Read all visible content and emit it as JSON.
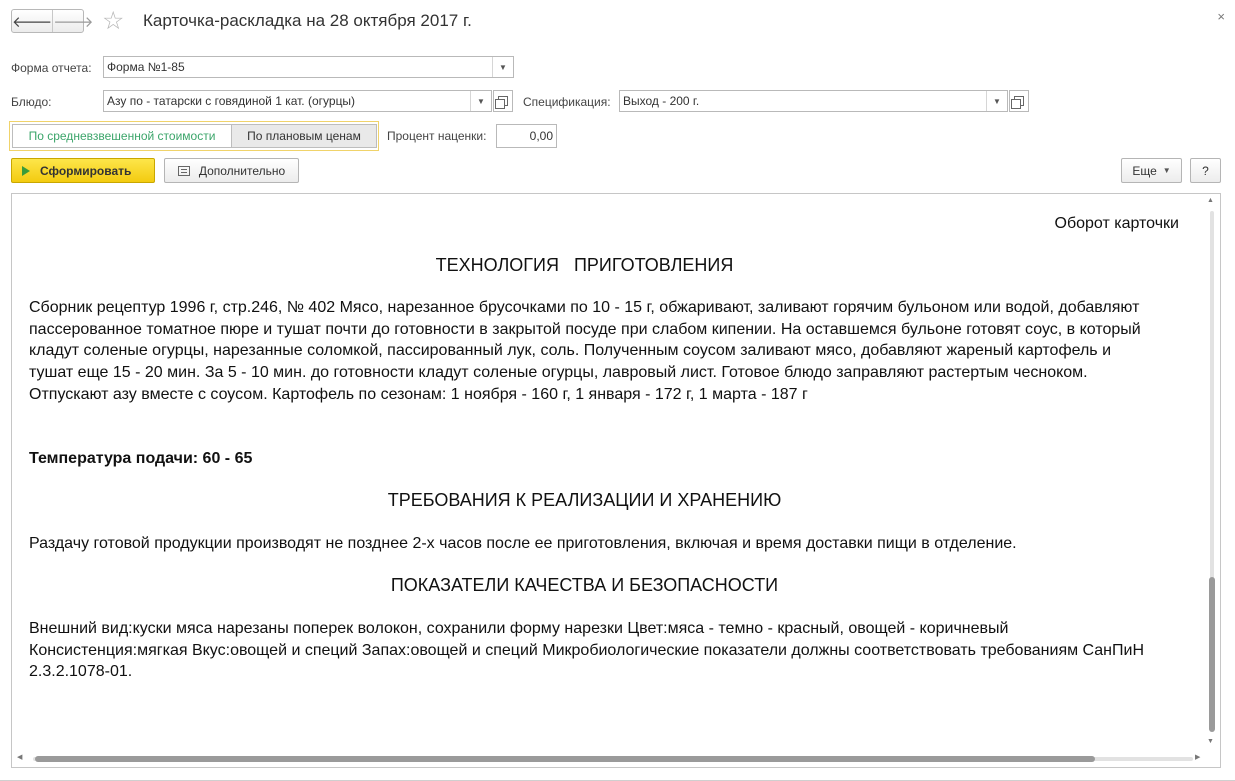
{
  "window": {
    "title": "Карточка-раскладка на 28 октября 2017 г.",
    "back_glyph": "🡐",
    "forward_glyph": "🡒",
    "star_glyph": "☆",
    "close_glyph": "×"
  },
  "form": {
    "report_form_label": "Форма отчета:",
    "report_form_value": "Форма №1-85",
    "dish_label": "Блюдо:",
    "dish_value": "Азу по - татарски с говядиной 1 кат. (огурцы)",
    "spec_label": "Спецификация:",
    "spec_value": "Выход - 200 г.",
    "dropdown_glyph": "▼"
  },
  "pricing": {
    "option_weighted": "По средневзвешенной стоимости",
    "option_planned": "По плановым ценам",
    "markup_label": "Процент наценки:",
    "markup_value": "0,00"
  },
  "toolbar": {
    "generate_label": "Сформировать",
    "additional_label": "Дополнительно",
    "more_label": "Еще",
    "more_caret": "▼",
    "help_label": "?"
  },
  "report": {
    "oborot": "Оборот карточки",
    "section1_title": "ТЕХНОЛОГИЯ   ПРИГОТОВЛЕНИЯ",
    "section1_text": "Сборник рецептур 1996 г, стр.246, № 402 Мясо, нарезанное брусочками по 10 - 15 г, обжаривают, заливают горячим бульоном или водой, добавляют пассерованное томатное пюре и тушат почти до готовности в закрытой посуде при слабом кипении. На оставшемся бульоне готовят соус, в который кладут соленые огурцы, нарезанные соломкой, пассированный лук, соль. Полученным соусом заливают  мясо, добавляют жареный картофель и тушат еще 15 - 20 мин. За 5 - 10 мин. до готовности кладут соленые огурцы, лавровый лист. Готовое блюдо заправляют растертым чесноком. Отпускают азу вместе с соусом. Картофель по сезонам:   1 ноября - 160 г, 1 января - 172 г, 1 марта - 187 г",
    "temperature": "Температура подачи: 60 - 65",
    "section2_title": "ТРЕБОВАНИЯ К РЕАЛИЗАЦИИ И ХРАНЕНИЮ",
    "section2_text": "Раздачу готовой продукции производят не позднее 2-х часов после ее приготовления, включая и время доставки пищи в отделение.",
    "section3_title": "ПОКАЗАТЕЛИ КАЧЕСТВА И БЕЗОПАСНОСТИ",
    "section3_text": "Внешний вид:куски мяса нарезаны поперек волокон, сохранили форму нарезки Цвет:мяса - темно - красный, овощей - коричневый Консистенция:мягкая Вкус:овощей и специй Запах:овощей и специй Микробиологические показатели должны соответствовать требованиям СанПиН 2.3.2.1078-01."
  },
  "scrollbars": {
    "up": "▲",
    "down": "▼",
    "left": "◀",
    "right": "▶"
  },
  "colors": {
    "accent_yellow": "#f3cb10",
    "active_toggle_text": "#3ba56a"
  }
}
